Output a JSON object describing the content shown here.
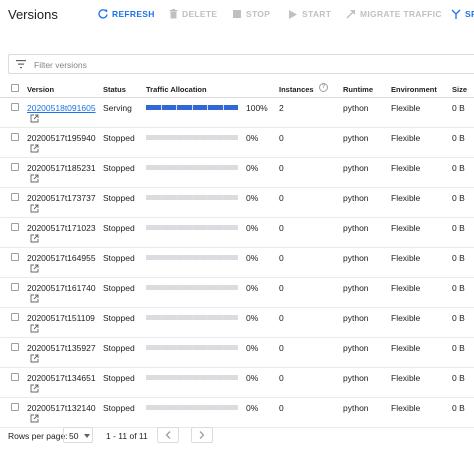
{
  "header": {
    "title": "Versions",
    "refresh_label": "REFRESH",
    "delete_label": "DELETE",
    "stop_label": "STOP",
    "start_label": "START",
    "migrate_label": "MIGRATE TRAFFIC",
    "split_label": "SPI"
  },
  "filter": {
    "placeholder": "Filter versions"
  },
  "table": {
    "headers": {
      "version": "Version",
      "status": "Status",
      "traffic": "Traffic Allocation",
      "instances": "Instances",
      "runtime": "Runtime",
      "environment": "Environment",
      "size": "Size"
    },
    "rows": [
      {
        "version": "20200518t091605",
        "status": "Serving",
        "traffic": "100%",
        "traffic_fraction": 1.0,
        "instances": "2",
        "runtime": "python",
        "environment": "Flexible",
        "size": "0 B"
      },
      {
        "version": "20200517t195940",
        "status": "Stopped",
        "traffic": "0%",
        "traffic_fraction": 0,
        "instances": "0",
        "runtime": "python",
        "environment": "Flexible",
        "size": "0 B"
      },
      {
        "version": "20200517t185231",
        "status": "Stopped",
        "traffic": "0%",
        "traffic_fraction": 0,
        "instances": "0",
        "runtime": "python",
        "environment": "Flexible",
        "size": "0 B"
      },
      {
        "version": "20200517t173737",
        "status": "Stopped",
        "traffic": "0%",
        "traffic_fraction": 0,
        "instances": "0",
        "runtime": "python",
        "environment": "Flexible",
        "size": "0 B"
      },
      {
        "version": "20200517t171023",
        "status": "Stopped",
        "traffic": "0%",
        "traffic_fraction": 0,
        "instances": "0",
        "runtime": "python",
        "environment": "Flexible",
        "size": "0 B"
      },
      {
        "version": "20200517t164955",
        "status": "Stopped",
        "traffic": "0%",
        "traffic_fraction": 0,
        "instances": "0",
        "runtime": "python",
        "environment": "Flexible",
        "size": "0 B"
      },
      {
        "version": "20200517t161740",
        "status": "Stopped",
        "traffic": "0%",
        "traffic_fraction": 0,
        "instances": "0",
        "runtime": "python",
        "environment": "Flexible",
        "size": "0 B"
      },
      {
        "version": "20200517t151109",
        "status": "Stopped",
        "traffic": "0%",
        "traffic_fraction": 0,
        "instances": "0",
        "runtime": "python",
        "environment": "Flexible",
        "size": "0 B"
      },
      {
        "version": "20200517t135927",
        "status": "Stopped",
        "traffic": "0%",
        "traffic_fraction": 0,
        "instances": "0",
        "runtime": "python",
        "environment": "Flexible",
        "size": "0 B"
      },
      {
        "version": "20200517t134651",
        "status": "Stopped",
        "traffic": "0%",
        "traffic_fraction": 0,
        "instances": "0",
        "runtime": "python",
        "environment": "Flexible",
        "size": "0 B"
      },
      {
        "version": "20200517t132140",
        "status": "Stopped",
        "traffic": "0%",
        "traffic_fraction": 0,
        "instances": "0",
        "runtime": "python",
        "environment": "Flexible",
        "size": "0 B"
      }
    ]
  },
  "footer": {
    "rows_per_page_label": "Rows per page:",
    "rows_per_page_value": "50",
    "range": "1 - 11 of 11"
  },
  "colors": {
    "accent": "#1a73e8",
    "traffic_bar": "#3367d6",
    "disabled": "#bdc1c6"
  }
}
